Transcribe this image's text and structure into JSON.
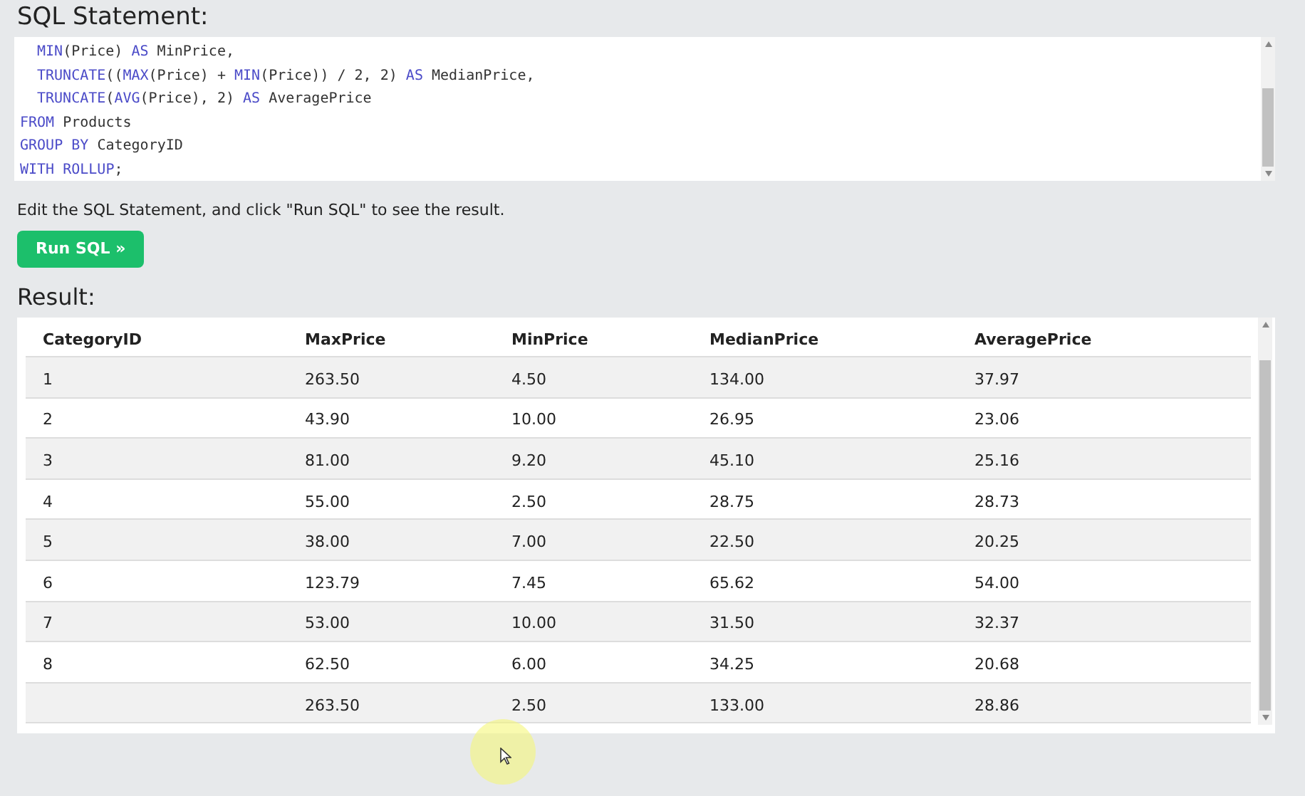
{
  "heading": "SQL Statement:",
  "code_lines": [
    {
      "indent": true,
      "tokens": [
        {
          "kind": "keyword",
          "text": "MIN"
        },
        {
          "kind": "text",
          "text": "(Price) "
        },
        {
          "kind": "keyword",
          "text": "AS"
        },
        {
          "kind": "text",
          "text": " MinPrice,"
        }
      ]
    },
    {
      "indent": true,
      "tokens": [
        {
          "kind": "keyword",
          "text": "TRUNCATE"
        },
        {
          "kind": "text",
          "text": "(("
        },
        {
          "kind": "keyword",
          "text": "MAX"
        },
        {
          "kind": "text",
          "text": "(Price) + "
        },
        {
          "kind": "keyword",
          "text": "MIN"
        },
        {
          "kind": "text",
          "text": "(Price)) / 2, 2) "
        },
        {
          "kind": "keyword",
          "text": "AS"
        },
        {
          "kind": "text",
          "text": " MedianPrice,"
        }
      ]
    },
    {
      "indent": true,
      "tokens": [
        {
          "kind": "keyword",
          "text": "TRUNCATE"
        },
        {
          "kind": "text",
          "text": "("
        },
        {
          "kind": "keyword",
          "text": "AVG"
        },
        {
          "kind": "text",
          "text": "(Price), 2) "
        },
        {
          "kind": "keyword",
          "text": "AS"
        },
        {
          "kind": "text",
          "text": " AveragePrice"
        }
      ]
    },
    {
      "indent": false,
      "tokens": [
        {
          "kind": "keyword",
          "text": "FROM"
        },
        {
          "kind": "text",
          "text": " Products"
        }
      ]
    },
    {
      "indent": false,
      "tokens": [
        {
          "kind": "keyword",
          "text": "GROUP BY"
        },
        {
          "kind": "text",
          "text": " CategoryID"
        }
      ]
    },
    {
      "indent": false,
      "tokens": [
        {
          "kind": "keyword",
          "text": "WITH ROLLUP"
        },
        {
          "kind": "text",
          "text": ";"
        }
      ]
    }
  ],
  "instruction": "Edit the SQL Statement, and click \"Run SQL\" to see the result.",
  "run_button": "Run SQL »",
  "result_heading": "Result:",
  "table": {
    "columns": [
      "CategoryID",
      "MaxPrice",
      "MinPrice",
      "MedianPrice",
      "AveragePrice"
    ],
    "rows": [
      [
        "1",
        "263.50",
        "4.50",
        "134.00",
        "37.97"
      ],
      [
        "2",
        "43.90",
        "10.00",
        "26.95",
        "23.06"
      ],
      [
        "3",
        "81.00",
        "9.20",
        "45.10",
        "25.16"
      ],
      [
        "4",
        "55.00",
        "2.50",
        "28.75",
        "28.73"
      ],
      [
        "5",
        "38.00",
        "7.00",
        "22.50",
        "20.25"
      ],
      [
        "6",
        "123.79",
        "7.45",
        "65.62",
        "54.00"
      ],
      [
        "7",
        "53.00",
        "10.00",
        "31.50",
        "32.37"
      ],
      [
        "8",
        "62.50",
        "6.00",
        "34.25",
        "20.68"
      ],
      [
        "",
        "263.50",
        "2.50",
        "133.00",
        "28.86"
      ]
    ]
  }
}
